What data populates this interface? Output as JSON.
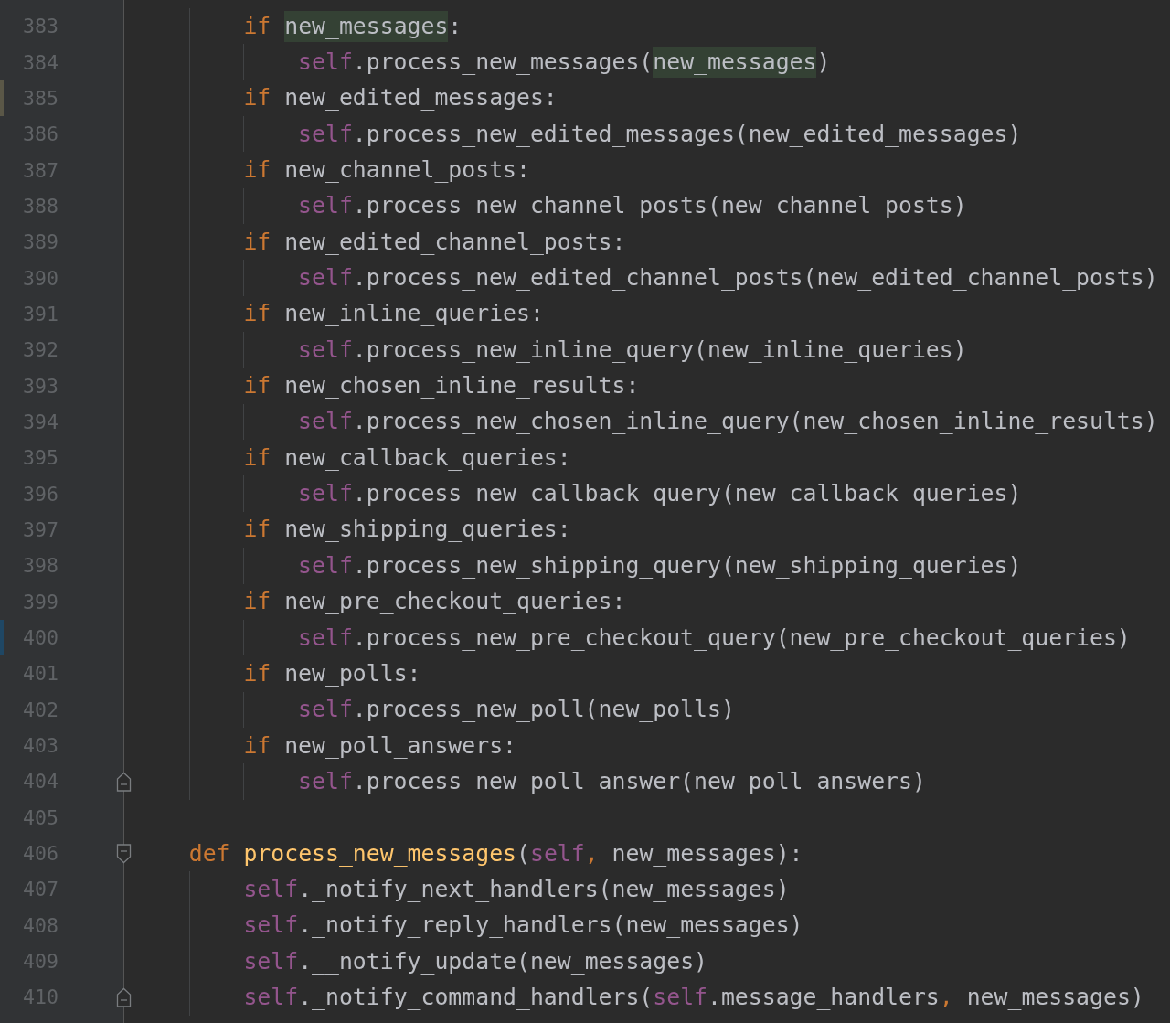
{
  "editor": {
    "lines": [
      {
        "number": "383",
        "kind": "statement",
        "tokens": [
          {
            "kind": "kw",
            "text": "if "
          },
          {
            "kind": "plain",
            "text": "new_messages",
            "highlight": true
          },
          {
            "kind": "plain",
            "text": ":"
          }
        ]
      },
      {
        "number": "384",
        "kind": "nested",
        "tokens": [
          {
            "kind": "self",
            "text": "self"
          },
          {
            "kind": "plain",
            "text": ".process_new_messages("
          },
          {
            "kind": "plain",
            "text": "new_messages",
            "highlight": true
          },
          {
            "kind": "plain",
            "text": ")"
          }
        ]
      },
      {
        "number": "385",
        "kind": "statement",
        "change_marker": {
          "color": "#5a5747"
        },
        "tokens": [
          {
            "kind": "kw",
            "text": "if"
          },
          {
            "kind": "plain",
            "text": " new_edited_messages:"
          }
        ]
      },
      {
        "number": "386",
        "kind": "nested",
        "tokens": [
          {
            "kind": "self",
            "text": "self"
          },
          {
            "kind": "plain",
            "text": ".process_new_edited_messages(new_edited_messages)"
          }
        ]
      },
      {
        "number": "387",
        "kind": "statement",
        "tokens": [
          {
            "kind": "kw",
            "text": "if"
          },
          {
            "kind": "plain",
            "text": " new_channel_posts:"
          }
        ]
      },
      {
        "number": "388",
        "kind": "nested",
        "tokens": [
          {
            "kind": "self",
            "text": "self"
          },
          {
            "kind": "plain",
            "text": ".process_new_channel_posts(new_channel_posts)"
          }
        ]
      },
      {
        "number": "389",
        "kind": "statement",
        "tokens": [
          {
            "kind": "kw",
            "text": "if"
          },
          {
            "kind": "plain",
            "text": " new_edited_channel_posts:"
          }
        ]
      },
      {
        "number": "390",
        "kind": "nested",
        "tokens": [
          {
            "kind": "self",
            "text": "self"
          },
          {
            "kind": "plain",
            "text": ".process_new_edited_channel_posts(new_edited_channel_posts)"
          }
        ]
      },
      {
        "number": "391",
        "kind": "statement",
        "tokens": [
          {
            "kind": "kw",
            "text": "if"
          },
          {
            "kind": "plain",
            "text": " new_inline_queries:"
          }
        ]
      },
      {
        "number": "392",
        "kind": "nested",
        "tokens": [
          {
            "kind": "self",
            "text": "self"
          },
          {
            "kind": "plain",
            "text": ".process_new_inline_query(new_inline_queries)"
          }
        ]
      },
      {
        "number": "393",
        "kind": "statement",
        "tokens": [
          {
            "kind": "kw",
            "text": "if"
          },
          {
            "kind": "plain",
            "text": " new_chosen_inline_results:"
          }
        ]
      },
      {
        "number": "394",
        "kind": "nested",
        "tokens": [
          {
            "kind": "self",
            "text": "self"
          },
          {
            "kind": "plain",
            "text": ".process_new_chosen_inline_query(new_chosen_inline_results)"
          }
        ]
      },
      {
        "number": "395",
        "kind": "statement",
        "tokens": [
          {
            "kind": "kw",
            "text": "if"
          },
          {
            "kind": "plain",
            "text": " new_callback_queries:"
          }
        ]
      },
      {
        "number": "396",
        "kind": "nested",
        "tokens": [
          {
            "kind": "self",
            "text": "self"
          },
          {
            "kind": "plain",
            "text": ".process_new_callback_query(new_callback_queries)"
          }
        ]
      },
      {
        "number": "397",
        "kind": "statement",
        "tokens": [
          {
            "kind": "kw",
            "text": "if"
          },
          {
            "kind": "plain",
            "text": " new_shipping_queries:"
          }
        ]
      },
      {
        "number": "398",
        "kind": "nested",
        "tokens": [
          {
            "kind": "self",
            "text": "self"
          },
          {
            "kind": "plain",
            "text": ".process_new_shipping_query(new_shipping_queries)"
          }
        ]
      },
      {
        "number": "399",
        "kind": "statement",
        "tokens": [
          {
            "kind": "kw",
            "text": "if"
          },
          {
            "kind": "plain",
            "text": " new_pre_checkout_queries:"
          }
        ]
      },
      {
        "number": "400",
        "kind": "nested",
        "change_marker": {
          "color": "#1f4764"
        },
        "tokens": [
          {
            "kind": "self",
            "text": "self"
          },
          {
            "kind": "plain",
            "text": ".process_new_pre_checkout_query(new_pre_checkout_queries)"
          }
        ]
      },
      {
        "number": "401",
        "kind": "statement",
        "tokens": [
          {
            "kind": "kw",
            "text": "if"
          },
          {
            "kind": "plain",
            "text": " new_polls:"
          }
        ]
      },
      {
        "number": "402",
        "kind": "nested",
        "tokens": [
          {
            "kind": "self",
            "text": "self"
          },
          {
            "kind": "plain",
            "text": ".process_new_poll(new_polls)"
          }
        ]
      },
      {
        "number": "403",
        "kind": "statement",
        "tokens": [
          {
            "kind": "kw",
            "text": "if"
          },
          {
            "kind": "plain",
            "text": " new_poll_answers:"
          }
        ]
      },
      {
        "number": "404",
        "kind": "nested",
        "fold_end": true,
        "tokens": [
          {
            "kind": "self",
            "text": "self"
          },
          {
            "kind": "plain",
            "text": ".process_new_poll_answer(new_poll_answers)"
          }
        ]
      },
      {
        "number": "405"
      },
      {
        "number": "406",
        "kind": "def",
        "fold_start": true,
        "tokens": [
          {
            "kind": "kw",
            "text": "def "
          },
          {
            "kind": "fn",
            "text": "process_new_messages"
          },
          {
            "kind": "plain",
            "text": "("
          },
          {
            "kind": "self",
            "text": "self"
          },
          {
            "kind": "kw",
            "text": ","
          },
          {
            "kind": "plain",
            "text": " new_messages):"
          }
        ]
      },
      {
        "number": "407",
        "kind": "statement",
        "tokens": [
          {
            "kind": "self",
            "text": "self"
          },
          {
            "kind": "plain",
            "text": "._notify_next_handlers(new_messages)"
          }
        ]
      },
      {
        "number": "408",
        "kind": "statement",
        "tokens": [
          {
            "kind": "self",
            "text": "self"
          },
          {
            "kind": "plain",
            "text": "._notify_reply_handlers(new_messages)"
          }
        ]
      },
      {
        "number": "409",
        "kind": "statement",
        "tokens": [
          {
            "kind": "self",
            "text": "self"
          },
          {
            "kind": "plain",
            "text": ".__notify_update(new_messages)"
          }
        ]
      },
      {
        "number": "410",
        "kind": "statement",
        "fold_end": true,
        "tokens": [
          {
            "kind": "self",
            "text": "self"
          },
          {
            "kind": "plain",
            "text": "._notify_command_handlers("
          },
          {
            "kind": "self",
            "text": "self"
          },
          {
            "kind": "plain",
            "text": ".message_handlers"
          },
          {
            "kind": "kw",
            "text": ","
          },
          {
            "kind": "plain",
            "text": " new_messages)"
          }
        ]
      }
    ]
  }
}
